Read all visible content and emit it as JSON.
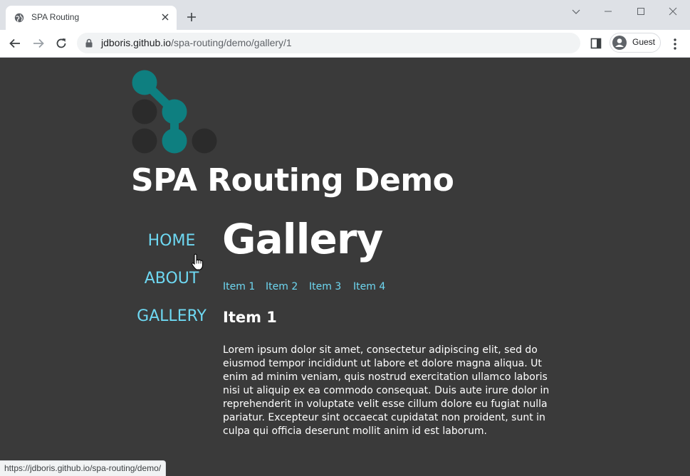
{
  "browser": {
    "tab": {
      "title": "SPA Routing",
      "favicon": "globe-icon"
    },
    "omnibox": {
      "host": "jdboris.github.io",
      "path": "/spa-routing/demo/gallery/1"
    },
    "profile": {
      "label": "Guest"
    },
    "status_url": "https://jdboris.github.io/spa-routing/demo/"
  },
  "site": {
    "title": "SPA Routing Demo",
    "logo": "routing-dots-logo"
  },
  "nav": {
    "items": [
      "HOME",
      "ABOUT",
      "GALLERY"
    ]
  },
  "page": {
    "heading": "Gallery",
    "subnav": [
      "Item 1",
      "Item 2",
      "Item 3",
      "Item 4"
    ],
    "item_heading": "Item 1",
    "item_body": "Lorem ipsum dolor sit amet, consectetur adipiscing elit, sed do eiusmod tempor incididunt ut labore et dolore magna aliqua. Ut enim ad minim veniam, quis nostrud exercitation ullamco laboris nisi ut aliquip ex ea commodo consequat. Duis aute irure dolor in reprehenderit in voluptate velit esse cillum dolore eu fugiat nulla pariatur. Excepteur sint occaecat cupidatat non proident, sunt in culpa qui officia deserunt mollit anim id est laborum."
  },
  "colors": {
    "page_background": "#3a3a3a",
    "link": "#6ed8f2",
    "logo_teal": "#0e7f80",
    "logo_dark": "#2b2b2b"
  }
}
